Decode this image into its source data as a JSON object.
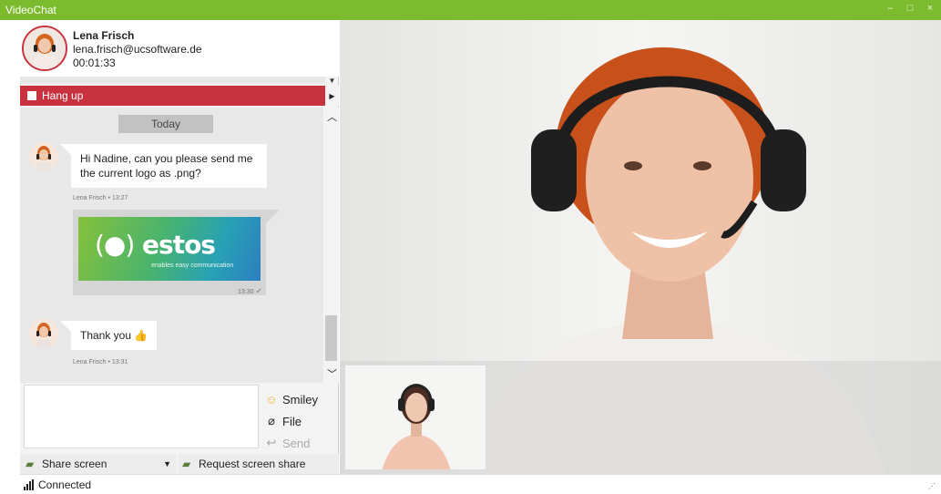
{
  "window": {
    "title": "VideoChat",
    "controls": {
      "minimize": "–",
      "maximize": "□",
      "close": "×"
    }
  },
  "contact": {
    "name": "Lena Frisch",
    "email": "lena.frisch@ucsoftware.de",
    "duration": "00:01:33"
  },
  "hangup": {
    "label": "Hang up"
  },
  "chat": {
    "date_divider": "Today",
    "messages": [
      {
        "text": "Hi Nadine, can you please send me the current logo as .png?",
        "meta": "Lena Frisch • 13:27"
      },
      {
        "image_brand": "estos",
        "image_tagline": "enables easy communication",
        "meta": "13:30"
      },
      {
        "text": "Thank you",
        "emoji": "👍",
        "meta": "Lena Frisch • 13:31"
      }
    ]
  },
  "compose": {
    "placeholder": ""
  },
  "actions": {
    "smiley": "Smiley",
    "file": "File",
    "send": "Send"
  },
  "screen_share": {
    "share_label": "Share screen",
    "request_label": "Request screen share"
  },
  "status": {
    "text": "Connected"
  },
  "colors": {
    "title_bar": "#7dbb2e",
    "hangup": "#c8323f",
    "chat_bg": "#e8e8e8"
  }
}
